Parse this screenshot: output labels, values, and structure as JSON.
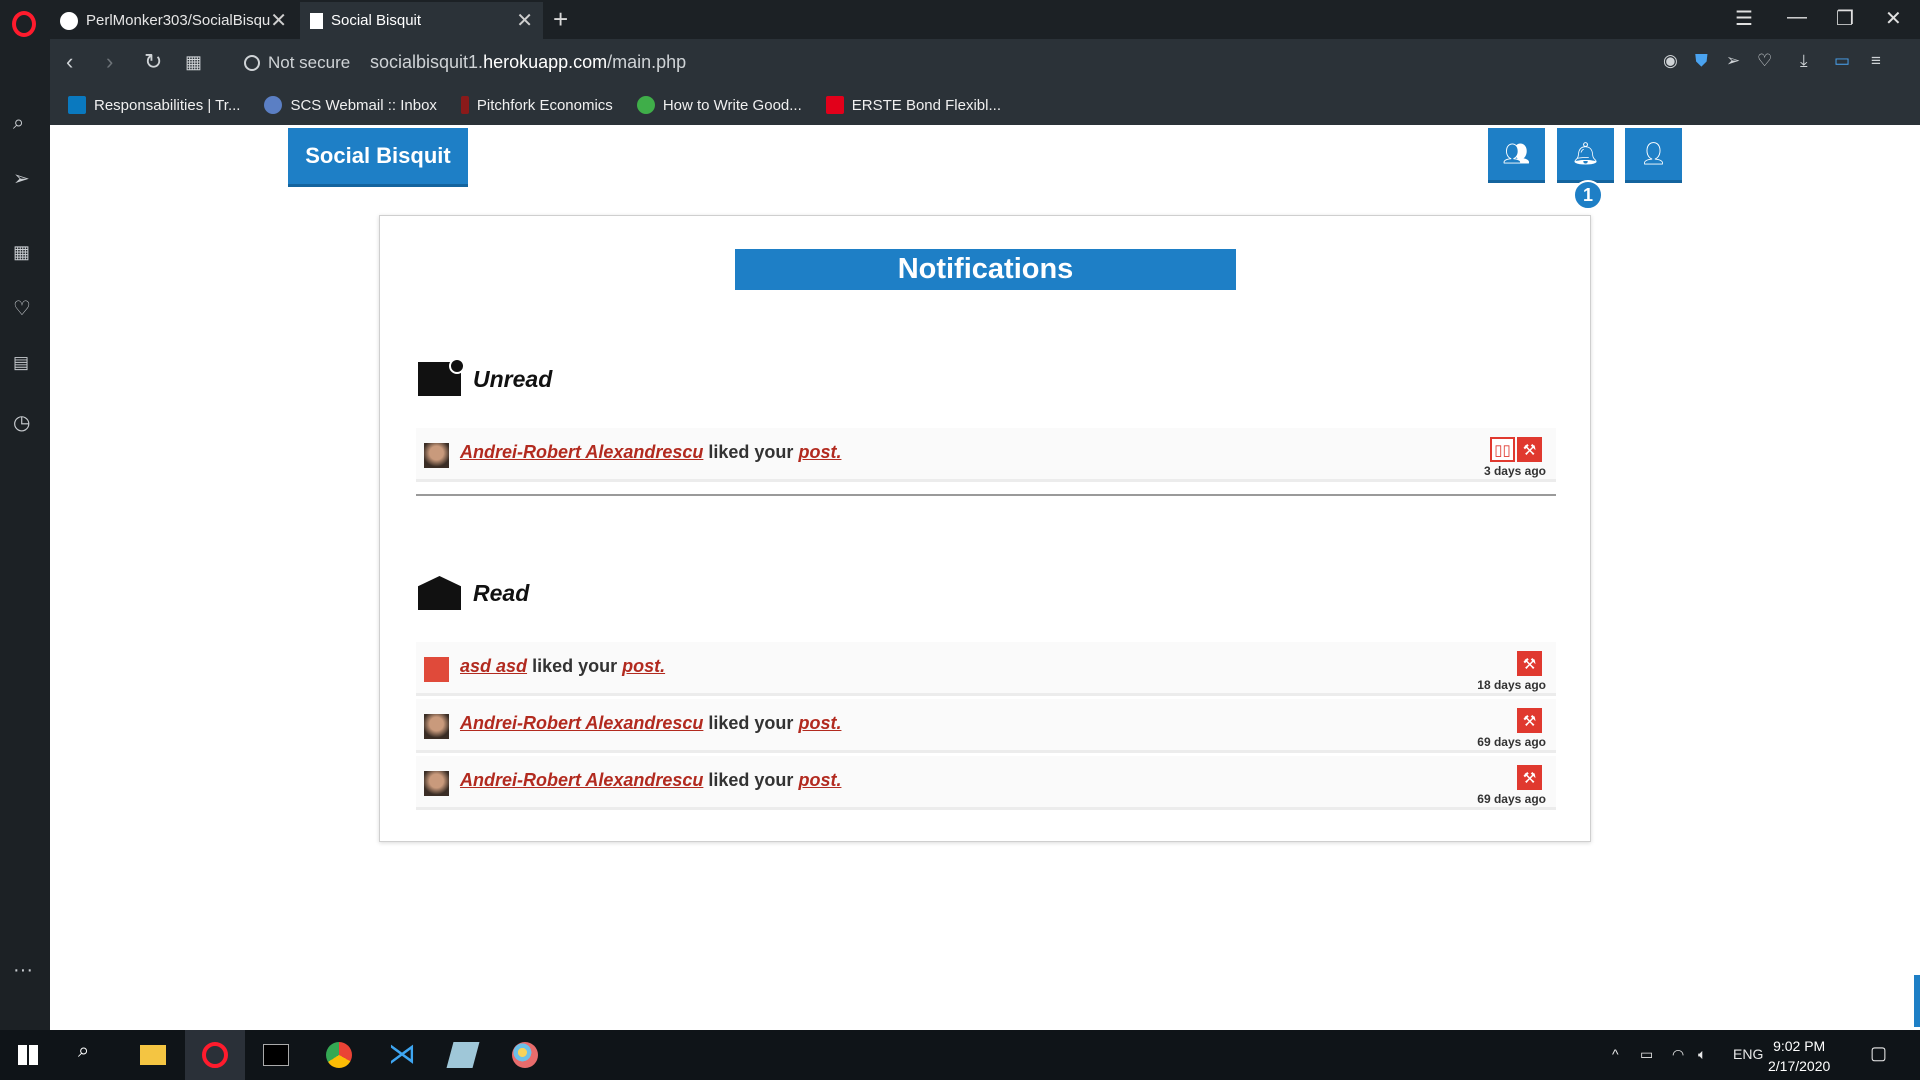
{
  "browser": {
    "tabs": [
      {
        "label": "PerlMonker303/SocialBisqu",
        "active": false
      },
      {
        "label": "Social Bisquit",
        "active": true
      }
    ],
    "security_label": "Not secure",
    "url_prefix": "socialbisquit1.",
    "url_domain": "herokuapp.com",
    "url_path": "/main.php",
    "bookmarks": [
      {
        "label": "Responsabilities | Tr...",
        "icon": "trello-icon",
        "color": "#0a79bf"
      },
      {
        "label": "SCS Webmail :: Inbox",
        "icon": "webmail-icon",
        "color": "#5b7fc4"
      },
      {
        "label": "Pitchfork Economics",
        "icon": "pitchfork-icon",
        "color": "#8a1a1a"
      },
      {
        "label": "How to Write Good...",
        "icon": "feather-icon",
        "color": "#3fae49"
      },
      {
        "label": "ERSTE Bond Flexibl...",
        "icon": "erste-icon",
        "color": "#e2001a"
      }
    ]
  },
  "app": {
    "brand": "Social Bisquit",
    "notification_count": "1",
    "title": "Notifications",
    "accent": "#1e7fc6",
    "link_color": "#b22a1f",
    "unread_heading": "Unread",
    "read_heading": "Read",
    "unread": [
      {
        "user": "Andrei-Robert Alexandrescu",
        "action": "liked your",
        "target": "post.",
        "ago": "3 days ago",
        "avatar": "photo",
        "icons": [
          "book-icon",
          "hammer-icon"
        ]
      }
    ],
    "read": [
      {
        "user": "asd asd",
        "action": "liked your",
        "target": "post.",
        "ago": "18 days ago",
        "avatar": "red",
        "icons": [
          "hammer-icon"
        ]
      },
      {
        "user": "Andrei-Robert Alexandrescu",
        "action": "liked your",
        "target": "post.",
        "ago": "69 days ago",
        "avatar": "photo",
        "icons": [
          "hammer-icon"
        ]
      },
      {
        "user": "Andrei-Robert Alexandrescu",
        "action": "liked your",
        "target": "post.",
        "ago": "69 days ago",
        "avatar": "photo",
        "icons": [
          "hammer-icon"
        ]
      }
    ]
  },
  "taskbar": {
    "lang": "ENG",
    "time": "9:02 PM",
    "date": "2/17/2020"
  }
}
